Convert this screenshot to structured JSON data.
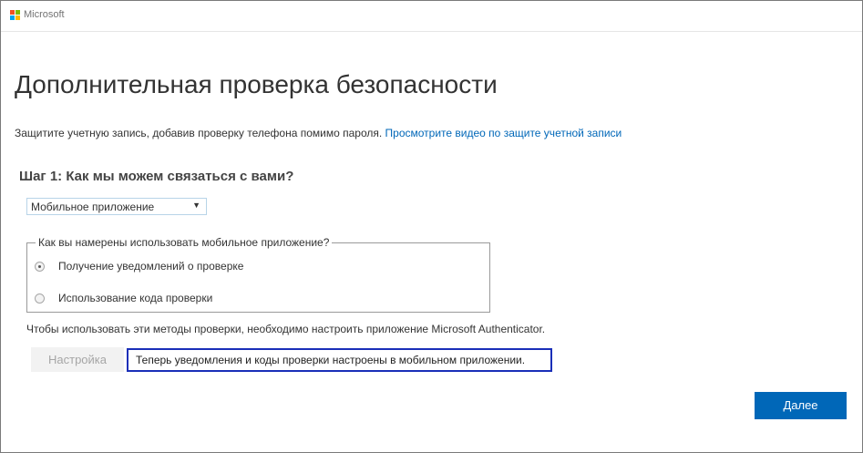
{
  "header": {
    "brand": "Microsoft",
    "logo_colors": [
      "#f25022",
      "#7fba00",
      "#00a4ef",
      "#ffb900"
    ]
  },
  "page": {
    "title": "Дополнительная проверка безопасности",
    "description": "Защитите учетную запись, добавив проверку телефона помимо пароля.",
    "video_link": "Просмотрите видео по защите учетной записи"
  },
  "step": {
    "heading": "Шаг 1: Как мы можем связаться с вами?",
    "method_selected": "Мобильное приложение",
    "usage_legend": "Как вы намерены использовать мобильное приложение?",
    "options": [
      {
        "label": "Получение уведомлений о проверке",
        "checked": true
      },
      {
        "label": "Использование кода проверки",
        "checked": false
      }
    ],
    "note": "Чтобы использовать эти методы проверки, необходимо настроить приложение Microsoft Authenticator.",
    "setup_label": "Настройка",
    "status_message": "Теперь уведомления и коды проверки настроены в мобильном приложении."
  },
  "footer": {
    "next_label": "Далее"
  },
  "colors": {
    "accent": "#0067b8",
    "highlight_border": "#1a2fb8"
  }
}
